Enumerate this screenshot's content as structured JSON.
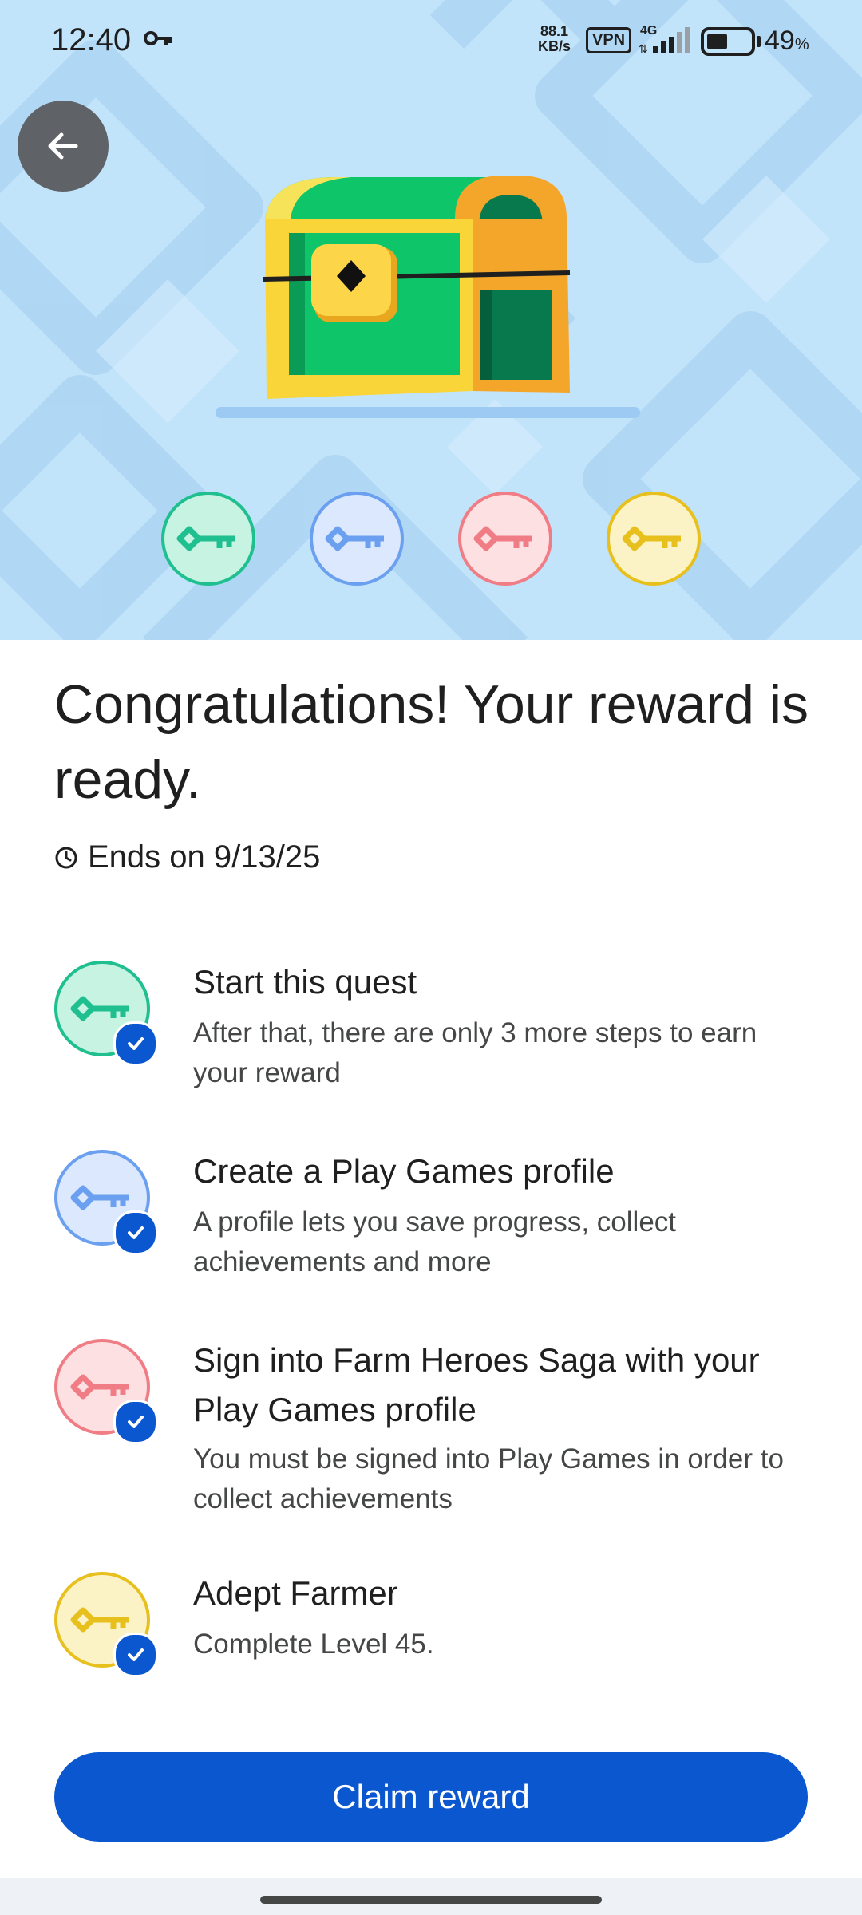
{
  "status_bar": {
    "time": "12:40",
    "net_speed_value": "88.1",
    "net_speed_unit": "KB/s",
    "vpn": "VPN",
    "network": "4G",
    "battery_percent": "49",
    "battery_unit": "%",
    "battery_level": 0.49
  },
  "header": {
    "back_icon": "arrow-left-icon",
    "illustration": "treasure-chest",
    "keys": [
      {
        "icon": "key-icon",
        "color": "#1fbf8f",
        "fill": "#c6f3e2"
      },
      {
        "icon": "key-icon",
        "color": "#6b9ff0",
        "fill": "#dbe8fd"
      },
      {
        "icon": "key-icon",
        "color": "#f07d86",
        "fill": "#fde0e2"
      },
      {
        "icon": "key-icon",
        "color": "#e8c01e",
        "fill": "#fbf3c6"
      }
    ]
  },
  "main": {
    "title": "Congratulations! Your reward is ready.",
    "ends_icon": "clock-icon",
    "ends_text": "Ends on 9/13/25",
    "steps": [
      {
        "title": "Start this quest",
        "description": "After that, there are only 3 more steps to earn your reward",
        "completed": true,
        "icon": "key-icon",
        "color": "#1fbf8f",
        "fill": "#c6f3e2"
      },
      {
        "title": "Create a Play Games profile",
        "description": "A profile lets you save progress, collect achievements and more",
        "completed": true,
        "icon": "key-icon",
        "color": "#6b9ff0",
        "fill": "#dbe8fd"
      },
      {
        "title": "Sign into Farm Heroes Saga with your Play Games profile",
        "description": "You must be signed into Play Games in order to collect achievements",
        "completed": true,
        "icon": "key-icon",
        "color": "#f07d86",
        "fill": "#fde0e2"
      },
      {
        "title": "Adept Farmer",
        "description": "Complete Level 45.",
        "completed": true,
        "icon": "key-icon",
        "color": "#e8c01e",
        "fill": "#fbf3c6"
      }
    ],
    "claim_label": "Claim reward"
  },
  "colors": {
    "hero_background": "#c2e4fb",
    "primary_button": "#0b57d0",
    "check_badge": "#0b57d0"
  }
}
